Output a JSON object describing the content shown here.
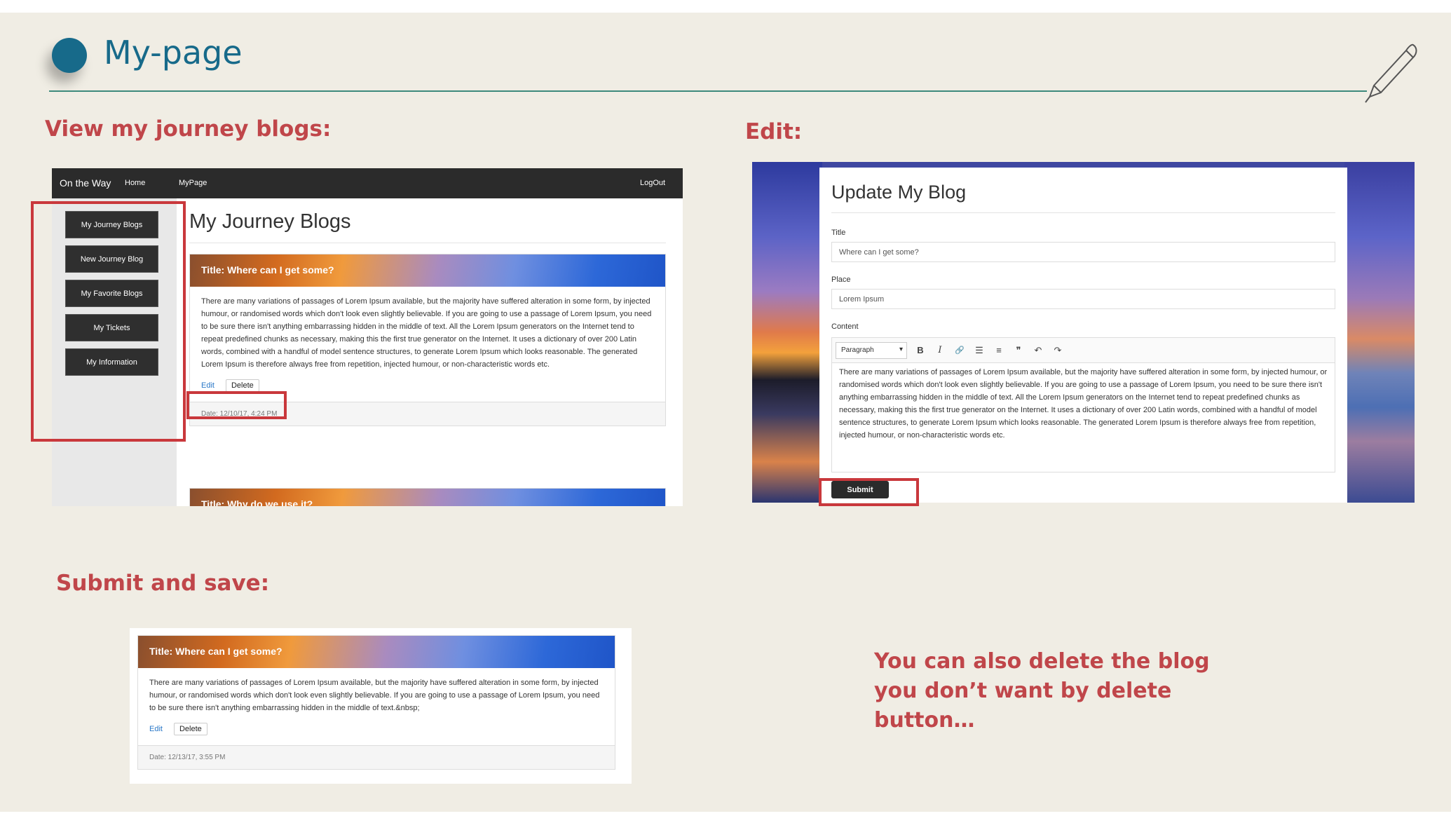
{
  "slide": {
    "title": "My-page",
    "heading_view": "View my journey blogs:",
    "heading_edit": "Edit:",
    "heading_submit": "Submit and save:",
    "note": "You can also delete the blog you don’t want by delete button…"
  },
  "screen_list": {
    "navbar": {
      "brand": "On the Way",
      "home": "Home",
      "mypage": "MyPage",
      "logout": "LogOut"
    },
    "sidebar": [
      "My Journey Blogs",
      "New Journey Blog",
      "My Favorite Blogs",
      "My Tickets",
      "My Information"
    ],
    "heading": "My Journey Blogs",
    "post1": {
      "title": "Title: Where can I get some?",
      "body": "There are many variations of passages of Lorem Ipsum available, but the majority have suffered alteration in some form, by injected humour, or randomised words which don't look even slightly believable. If you are going to use a passage of Lorem Ipsum, you need to be sure there isn't anything embarrassing hidden in the middle of text. All the Lorem Ipsum generators on the Internet tend to repeat predefined chunks as necessary, making this the first true generator on the Internet. It uses a dictionary of over 200 Latin words, combined with a handful of model sentence structures, to generate Lorem Ipsum which looks reasonable. The generated Lorem Ipsum is therefore always free from repetition, injected humour, or non-characteristic words etc.",
      "edit": "Edit",
      "delete": "Delete",
      "date": "Date: 12/10/17, 4:24 PM"
    },
    "post2": {
      "title": "Title: Why do we use it?"
    }
  },
  "screen_edit": {
    "heading": "Update My Blog",
    "title_label": "Title",
    "title_value": "Where can I get some?",
    "place_label": "Place",
    "place_value": "Lorem Ipsum",
    "content_label": "Content",
    "format_select": "Paragraph",
    "toolbar": {
      "bold": "B",
      "italic": "I",
      "link": "🔗",
      "bullets": "☰",
      "numbers": "≡",
      "quote": "❞",
      "undo": "↶",
      "redo": "↷"
    },
    "content": "There are many variations of passages of Lorem Ipsum available, but the majority have suffered alteration in some form, by injected humour, or randomised words which don't look even slightly believable. If you are going to use a passage of Lorem Ipsum, you need to be sure there isn't anything embarrassing hidden in the middle of text. All the Lorem Ipsum generators on the Internet tend to repeat predefined chunks as necessary, making this the first true generator on the Internet. It uses a dictionary of over 200 Latin words, combined with a handful of model sentence structures, to generate Lorem Ipsum which looks reasonable. The generated Lorem Ipsum is therefore always free from repetition, injected humour, or non-characteristic words etc.",
    "submit": "Submit"
  },
  "screen_saved": {
    "title": "Title: Where can I get some?",
    "body": "There are many variations of passages of Lorem Ipsum available, but the majority have suffered alteration in some form, by injected humour, or randomised words which don't look even slightly believable. If you are going to use a passage of Lorem Ipsum, you need to be sure there isn't anything embarrassing hidden in the middle of text.&nbsp;",
    "edit": "Edit",
    "delete": "Delete",
    "date": "Date: 12/13/17, 3:55 PM"
  },
  "colors": {
    "accent_teal": "#176a8a",
    "heading_red": "#c0464a",
    "highlight_red": "#c9383c",
    "background": "#f0ede4"
  }
}
